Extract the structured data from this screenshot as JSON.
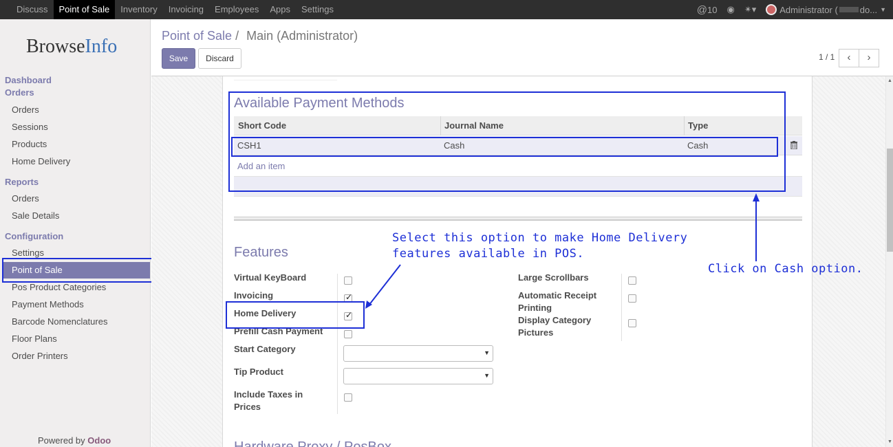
{
  "topbar": {
    "menu": [
      "Discuss",
      "Point of Sale",
      "Inventory",
      "Invoicing",
      "Employees",
      "Apps",
      "Settings"
    ],
    "active": "Point of Sale",
    "messages_count": "10",
    "user": "Administrator (",
    "user_suffix": "do..."
  },
  "sidebar": {
    "logo_browse": "Browse",
    "logo_info": "Info",
    "dashboard": "Dashboard",
    "orders_section": "Orders",
    "orders_items": [
      "Orders",
      "Sessions",
      "Products",
      "Home Delivery"
    ],
    "reports_section": "Reports",
    "reports_items": [
      "Orders",
      "Sale Details"
    ],
    "configuration_section": "Configuration",
    "configuration_items": [
      "Settings",
      "Point of Sale",
      "Pos Product Categories",
      "Payment Methods",
      "Barcode Nomenclatures",
      "Floor Plans",
      "Order Printers"
    ],
    "active_item": "Point of Sale",
    "powered_by": "Powered by",
    "powered_brand": "Odoo"
  },
  "control_panel": {
    "breadcrumb_link": "Point of Sale",
    "breadcrumb_sep": "/",
    "breadcrumb_current": "Main (Administrator)",
    "save_label": "Save",
    "discard_label": "Discard",
    "pager": "1 / 1"
  },
  "payment_methods": {
    "title": "Available Payment Methods",
    "columns": [
      "Short Code",
      "Journal Name",
      "Type"
    ],
    "rows": [
      {
        "short_code": "CSH1",
        "journal_name": "Cash",
        "type": "Cash"
      }
    ],
    "add_item": "Add an item"
  },
  "features": {
    "title": "Features",
    "left": [
      {
        "label": "Virtual KeyBoard",
        "checked": false
      },
      {
        "label": "Invoicing",
        "checked": true
      },
      {
        "label": "Home Delivery",
        "checked": true
      },
      {
        "label": "Prefill Cash Payment",
        "checked": false
      }
    ],
    "start_category": "Start Category",
    "tip_product": "Tip Product",
    "include_taxes_1": "Include Taxes in",
    "include_taxes_2": "Prices",
    "right": [
      {
        "label": "Large Scrollbars",
        "checked": false
      },
      {
        "label_1": "Automatic Receipt",
        "label_2": "Printing",
        "checked": false
      },
      {
        "label_1": "Display Category",
        "label_2": "Pictures",
        "checked": false
      }
    ]
  },
  "hardware_title": "Hardware Proxy / PosBox",
  "annotations": {
    "select_note_line1": "Select this option to make Home Delivery",
    "select_note_line2": "features available in POS.",
    "cash_note": "Click on Cash option.",
    "color": "#1d2fd6"
  }
}
